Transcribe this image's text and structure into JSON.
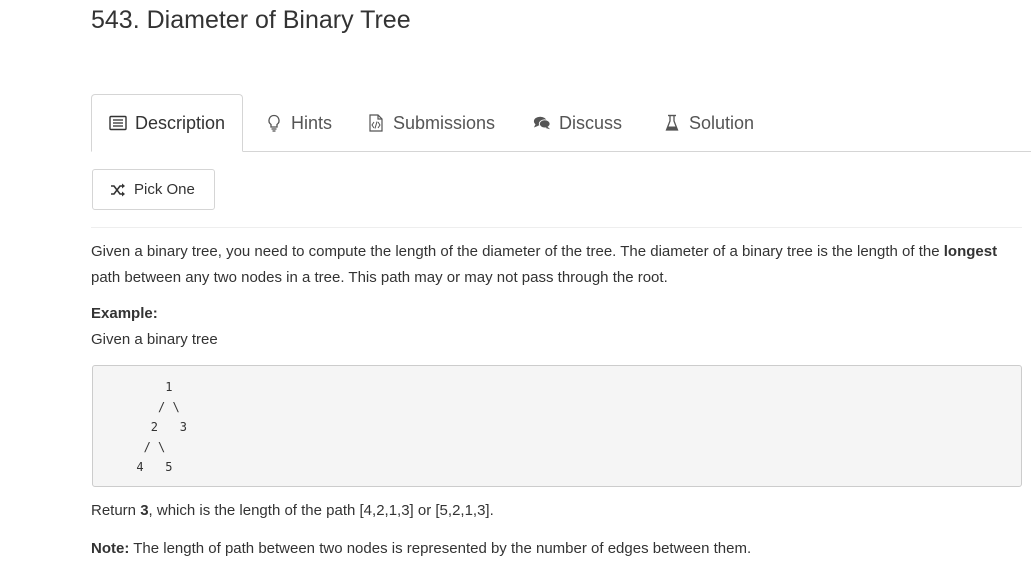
{
  "problem": {
    "title": "543. Diameter of Binary Tree"
  },
  "tabs": [
    {
      "label": "Description",
      "icon": "list-icon",
      "active": true
    },
    {
      "label": "Hints",
      "icon": "lightbulb-icon"
    },
    {
      "label": "Submissions",
      "icon": "code-file-icon"
    },
    {
      "label": "Discuss",
      "icon": "comments-icon"
    },
    {
      "label": "Solution",
      "icon": "flask-icon"
    }
  ],
  "pick_one": {
    "label": "Pick One",
    "icon": "shuffle-icon"
  },
  "description": {
    "p1": "Given a binary tree, you need to compute the length of the diameter of the tree. The diameter of a binary tree is the length of the ",
    "p1_bold": "longest",
    "p2": "path between any two nodes in a tree. This path may or may not pass through the root.",
    "example_heading": "Example:",
    "example_sub": "Given a binary tree",
    "code_lines": [
      "          1",
      "         / \\",
      "        2   3",
      "       / \\",
      "      4   5"
    ],
    "return_prefix": "Return ",
    "return_bold": "3",
    "return_rest": ", which is the length of the path [4,2,1,3] or [5,2,1,3].",
    "note_label": "Note:",
    "note_text": " The length of path between two nodes is represented by the number of edges between them."
  }
}
